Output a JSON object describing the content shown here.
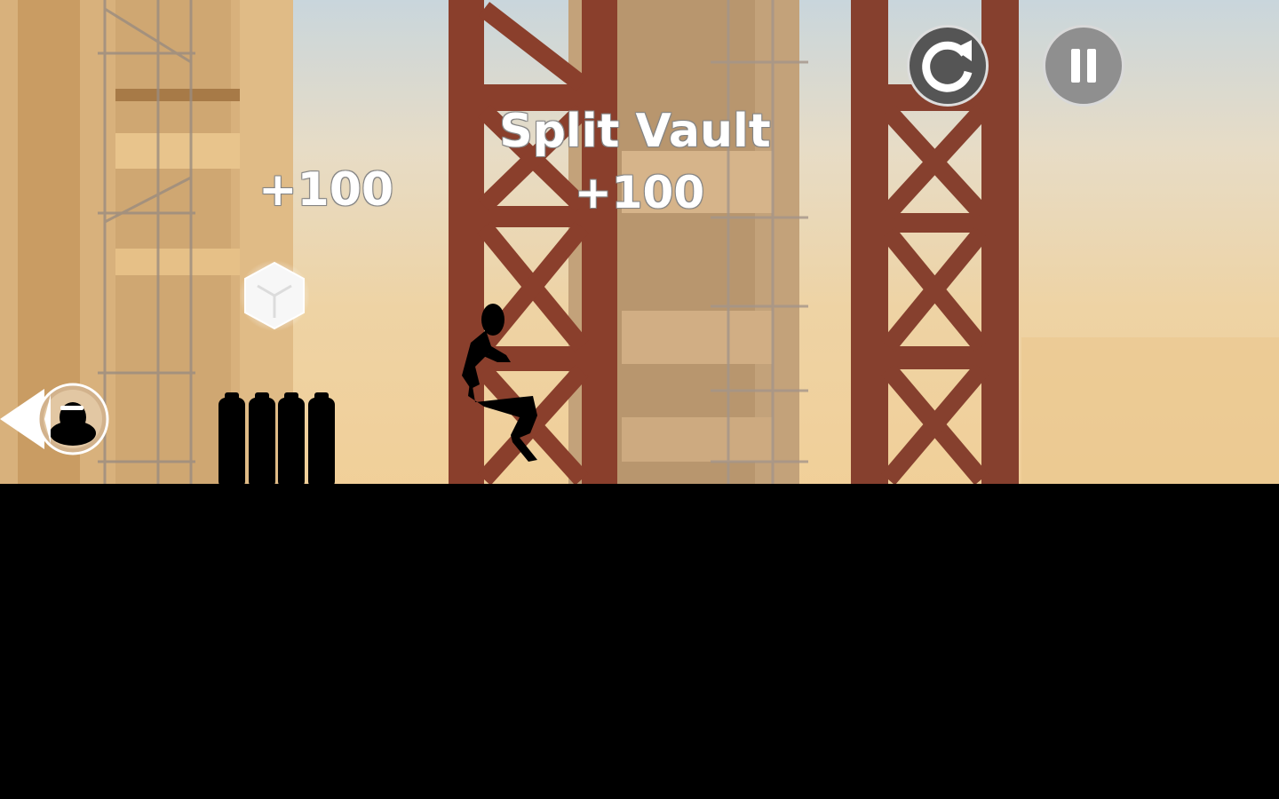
{
  "hud": {
    "restart_icon": "restart-icon",
    "pause_icon": "pause-icon"
  },
  "popups": {
    "trick_name": "Split Vault",
    "trick_score": "+100",
    "bonus_score": "+100"
  },
  "colors": {
    "sky_top": "#c9d6dc",
    "sky_bottom": "#f1cf98",
    "girder": "#8a3f2c",
    "ground": "#000000"
  }
}
